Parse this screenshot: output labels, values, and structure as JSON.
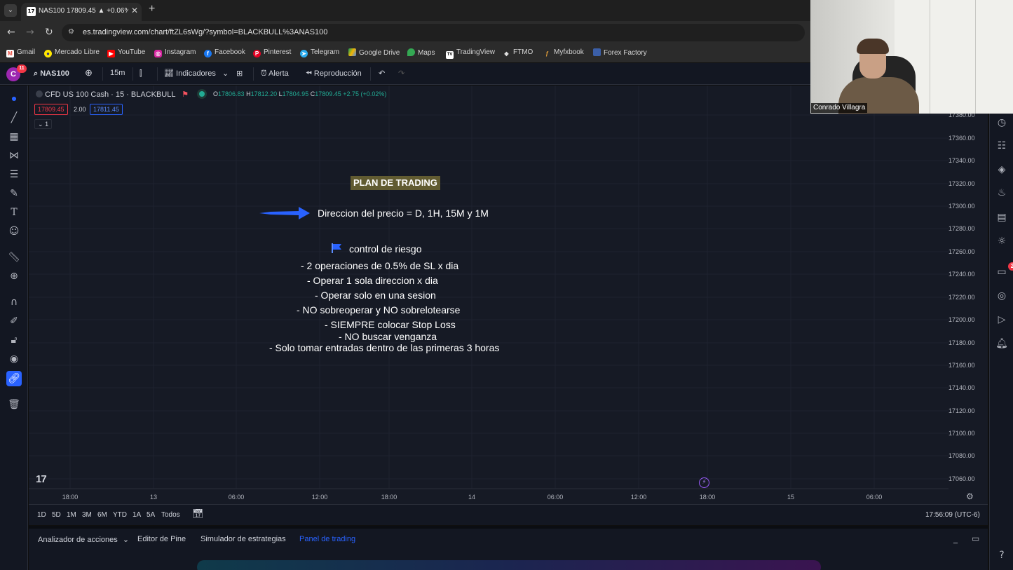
{
  "browser": {
    "tab_title": "NAS100 17809.45 ▲ +0.06% Si",
    "url": "es.tradingview.com/chart/ftZL6sWg/?symbol=BLACKBULL%3ANAS100",
    "bookmarks": [
      "Gmail",
      "Mercado Libre",
      "YouTube",
      "Instagram",
      "Facebook",
      "Pinterest",
      "Telegram",
      "Google Drive",
      "Maps",
      "TradingView",
      "FTMO",
      "Myfxbook",
      "Forex Factory"
    ]
  },
  "topbar": {
    "avatar_letter": "C",
    "avatar_badge": "11",
    "symbol": "NAS100",
    "interval": "15m",
    "indicators": "Indicadores",
    "alert": "Alerta",
    "replay": "Reproducción"
  },
  "legend": {
    "title": "CFD US 100 Cash · 15 · BLACKBULL",
    "o_label": "O",
    "o": "17806.83",
    "h_label": "H",
    "h": "17812.20",
    "l_label": "L",
    "l": "17804.95",
    "c_label": "C",
    "c": "17809.45",
    "change": "+2.75 (+0.02%)",
    "bid": "17809.45",
    "spread": "2.00",
    "ask": "17811.45",
    "collapse": "1"
  },
  "plan": {
    "title": "PLAN DE TRADING",
    "direction": "Direccion del precio = D, 1H, 15M y 1M",
    "risk_title": "control de riesgo",
    "rules": [
      "- 2 operaciones de 0.5% de SL x dia",
      "- Operar 1 sola direccion x dia",
      "- Operar solo en una sesion",
      "- NO sobreoperar y NO sobrelotearse",
      "- SIEMPRE colocar Stop Loss",
      "- NO buscar venganza",
      "-  Solo tomar entradas dentro de las primeras 3 horas"
    ]
  },
  "price_axis": [
    "17380.00",
    "17360.00",
    "17340.00",
    "17320.00",
    "17300.00",
    "17280.00",
    "17260.00",
    "17240.00",
    "17220.00",
    "17200.00",
    "17180.00",
    "17160.00",
    "17140.00",
    "17120.00",
    "17100.00",
    "17080.00",
    "17060.00"
  ],
  "time_axis": [
    "18:00",
    "13",
    "06:00",
    "12:00",
    "18:00",
    "14",
    "06:00",
    "12:00",
    "18:00",
    "15",
    "06:00"
  ],
  "ranges": [
    "1D",
    "5D",
    "1M",
    "3M",
    "6M",
    "YTD",
    "1A",
    "5A",
    "Todos"
  ],
  "clock": "17:56:09 (UTC-6)",
  "bottom_tabs": [
    "Analizador de acciones",
    "Editor de Pine",
    "Simulador de estrategias",
    "Panel de trading"
  ],
  "right_badge": "2",
  "webcam_name": "Conrado Villagra",
  "colors": {
    "accent": "#2962ff",
    "up": "#22ab94",
    "down": "#f23645",
    "chart_bg": "#161a25",
    "plan_title_bg": "#615b31"
  }
}
